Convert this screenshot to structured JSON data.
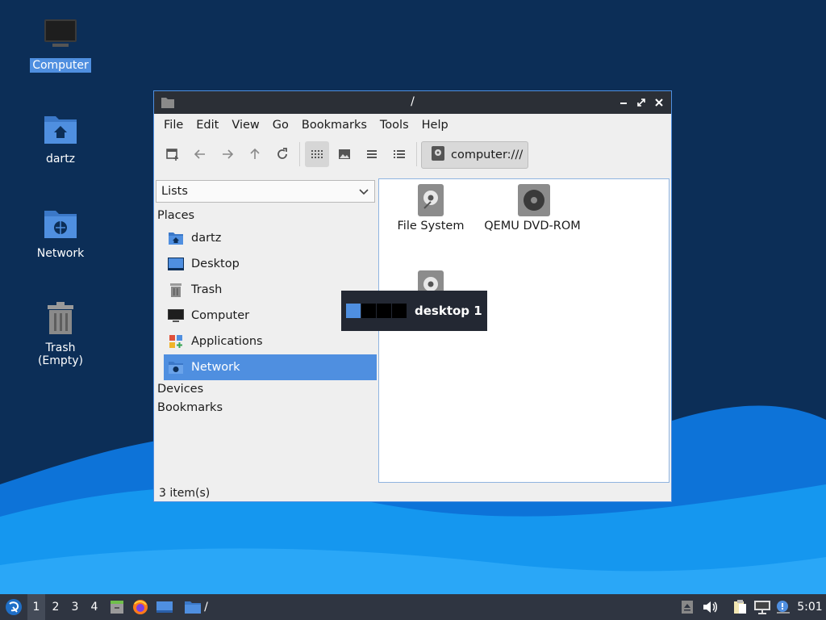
{
  "desktop": {
    "icons": [
      {
        "label": "Computer",
        "icon": "computer-icon",
        "selected": true
      },
      {
        "label": "dartz",
        "icon": "home-folder-icon"
      },
      {
        "label": "Network",
        "icon": "network-folder-icon"
      },
      {
        "label": "Trash (Empty)",
        "icon": "trash-icon"
      }
    ]
  },
  "window": {
    "title": "/",
    "menu": [
      "File",
      "Edit",
      "View",
      "Go",
      "Bookmarks",
      "Tools",
      "Help"
    ],
    "path_button": "computer:///",
    "side_mode": "Lists",
    "places_heading": "Places",
    "places": [
      {
        "label": "dartz",
        "icon": "home-folder-icon"
      },
      {
        "label": "Desktop",
        "icon": "desktop-icon"
      },
      {
        "label": "Trash",
        "icon": "trash-icon"
      },
      {
        "label": "Computer",
        "icon": "computer-icon"
      },
      {
        "label": "Applications",
        "icon": "applications-icon"
      },
      {
        "label": "Network",
        "icon": "network-icon",
        "selected": true
      }
    ],
    "devices_heading": "Devices",
    "bookmarks_heading": "Bookmarks",
    "files": [
      {
        "label": "File System",
        "icon": "drive-icon"
      },
      {
        "label": "QEMU DVD-ROM",
        "icon": "optical-drive-icon"
      },
      {
        "label": "",
        "icon": "drive-icon"
      }
    ],
    "status": "3 item(s)"
  },
  "osd": {
    "label": "desktop 1",
    "desktops": 4,
    "current": 1
  },
  "taskbar": {
    "workspaces": [
      "1",
      "2",
      "3",
      "4"
    ],
    "active_workspace": "1",
    "task_label": "/",
    "clock": "5:01"
  },
  "colors": {
    "accent": "#4f8fe0",
    "panel": "#2f3541",
    "titlebar": "#2b2f36"
  }
}
